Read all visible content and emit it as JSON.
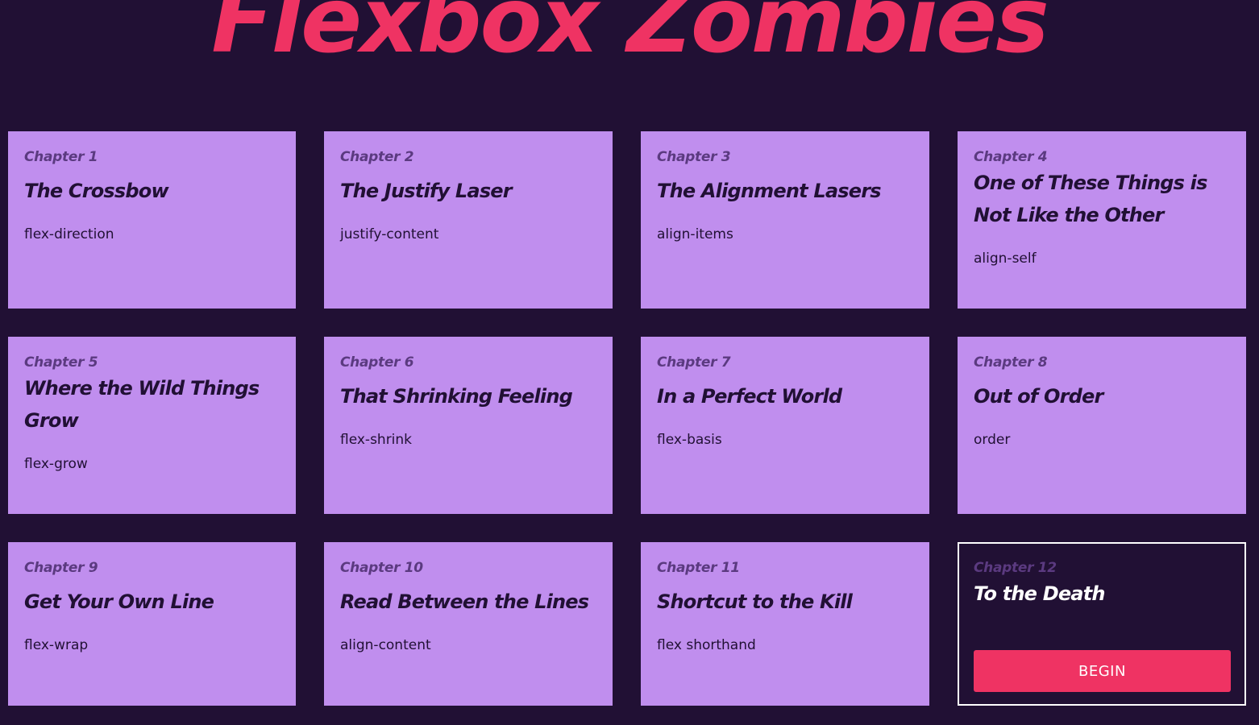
{
  "site": {
    "title": "Flexbox Zombies"
  },
  "chapters": [
    {
      "number": "Chapter 1",
      "title": "The Crossbow",
      "concept": "flex-direction"
    },
    {
      "number": "Chapter 2",
      "title": "The Justify Laser",
      "concept": "justify-content"
    },
    {
      "number": "Chapter 3",
      "title": "The Alignment Lasers",
      "concept": "align-items"
    },
    {
      "number": "Chapter 4",
      "title": "One of These Things is Not Like the Other",
      "concept": "align-self"
    },
    {
      "number": "Chapter 5",
      "title": "Where the Wild Things Grow",
      "concept": "flex-grow"
    },
    {
      "number": "Chapter 6",
      "title": "That Shrinking Feeling",
      "concept": "flex-shrink"
    },
    {
      "number": "Chapter 7",
      "title": "In a Perfect World",
      "concept": "flex-basis"
    },
    {
      "number": "Chapter 8",
      "title": "Out of Order",
      "concept": "order"
    },
    {
      "number": "Chapter 9",
      "title": "Get Your Own Line",
      "concept": "flex-wrap"
    },
    {
      "number": "Chapter 10",
      "title": "Read Between the Lines",
      "concept": "align-content"
    },
    {
      "number": "Chapter 11",
      "title": "Shortcut to the Kill",
      "concept": "flex shorthand"
    },
    {
      "number": "Chapter 12",
      "title": "To the Death",
      "button_label": "BEGIN"
    }
  ],
  "colors": {
    "background": "#211034",
    "card": "#c08eee",
    "accent": "#ef3363",
    "chapter_label": "#5b3a80"
  }
}
